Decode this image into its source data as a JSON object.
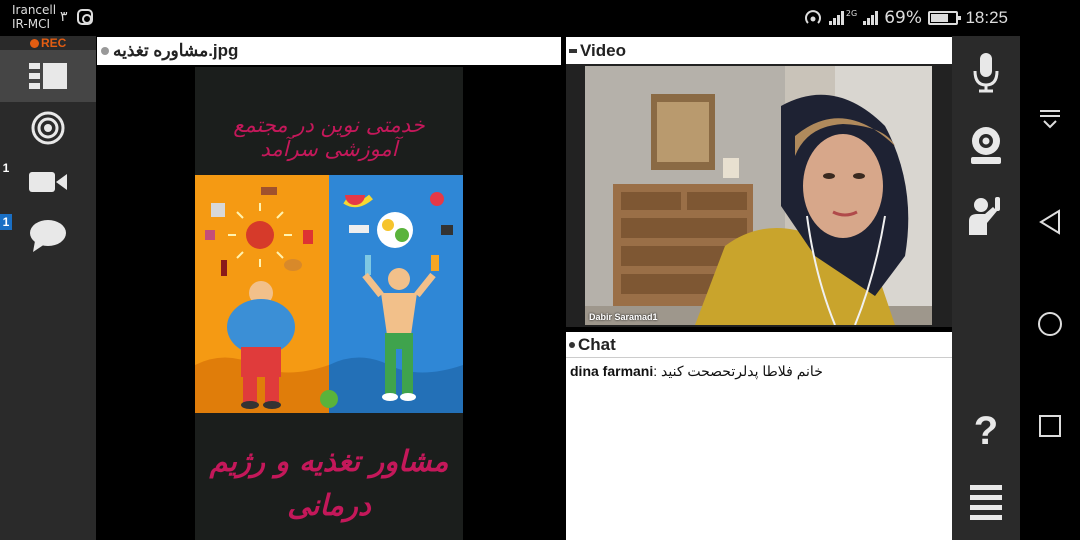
{
  "status_bar": {
    "carrier_line1": "Irancell",
    "carrier_line2": "IR-MCI",
    "carrier_digit": "۳",
    "network_label": "2G",
    "battery_percent": "69%",
    "battery_level": 0.69,
    "time": "18:25"
  },
  "sidebar": {
    "rec_label": "REC",
    "items": [
      {
        "icon": "layout-icon",
        "active": true
      },
      {
        "icon": "broadcast-icon"
      },
      {
        "icon": "camera-icon",
        "badge": "1"
      },
      {
        "icon": "chat-bubble-icon",
        "badge": "1"
      }
    ]
  },
  "presentation": {
    "filename": "مشاوره تغذیه.jpg",
    "poster_top_text": "خدمتی نوین در مجتمع آموزشی سرآمد",
    "poster_bottom_text": "مشاور تغذیه و رژیم درمانی",
    "colors": {
      "left": "#f59a13",
      "right": "#2f87d6",
      "text": "#c4185a"
    }
  },
  "video": {
    "title": "Video",
    "participant_name": "Dabir Saramad1"
  },
  "chat": {
    "title": "Chat",
    "messages": [
      {
        "author": "dina farmani",
        "text": "خانم  فلاطا پدلرتحصحت کنید"
      }
    ]
  },
  "right_toolbar": {
    "items": [
      "microphone-icon",
      "webcam-icon",
      "raise-hand-icon",
      "help-icon",
      "menu-icon"
    ],
    "help_label": "?"
  },
  "android_nav": {
    "items": [
      "notification-shade-icon",
      "back-icon",
      "home-icon",
      "recents-icon"
    ]
  }
}
